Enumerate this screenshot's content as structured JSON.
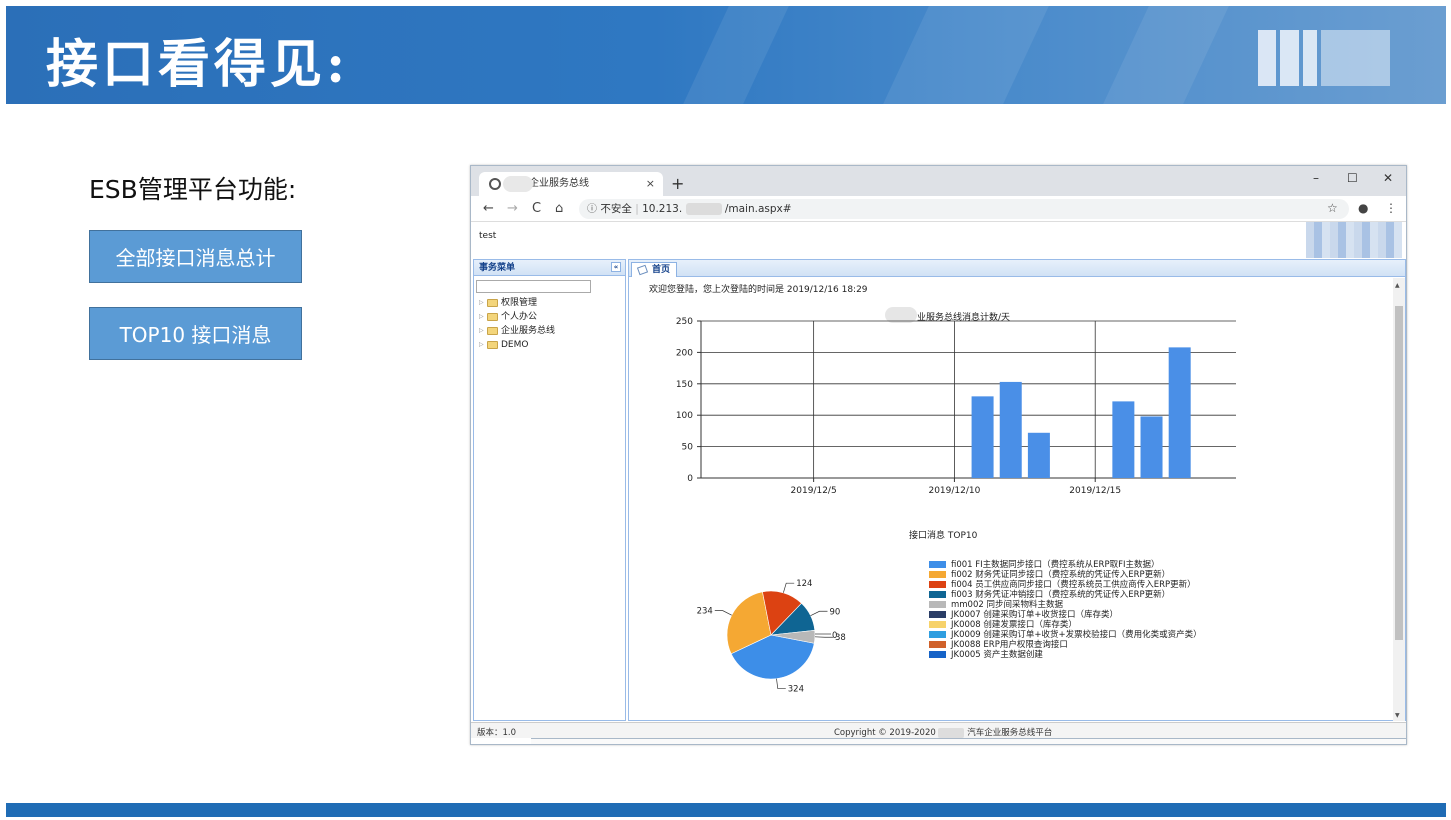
{
  "slide": {
    "title": "接口看得见:",
    "heading": "ESB管理平台功能:",
    "button_all": "全部接口消息总计",
    "button_top10": "TOP10 接口消息"
  },
  "browser": {
    "tab_title": "车企业服务总线",
    "tab_close": "×",
    "tab_new": "+",
    "win_min": "–",
    "win_max": "☐",
    "win_close": "✕",
    "nav_back": "←",
    "nav_forward": "→",
    "nav_reload": "C",
    "nav_home": "⌂",
    "info_icon": "ⓘ",
    "security": "不安全",
    "url_prefix": "10.213.",
    "url_suffix": "/main.aspx#",
    "star_icon": "☆",
    "profile_icon": "●",
    "menu_icon": "⋮"
  },
  "app": {
    "user": "test",
    "menu_title": "事务菜单",
    "menu_collapse": "«",
    "menu_items": [
      "权限管理",
      "个人办公",
      "企业服务总线",
      "DEMO"
    ],
    "tab_home": "首页",
    "welcome": "欢迎您登陆，您上次登陆的时间是 2019/12/16 18:29",
    "version": "版本：1.0",
    "copyright_prefix": "Copyright © 2019-2020",
    "copyright_suffix": "汽车企业服务总线平台"
  },
  "chart_data": [
    {
      "type": "bar",
      "title": "业服务总线消息计数/天",
      "ylim": [
        0,
        250
      ],
      "yticks": [
        0,
        50,
        100,
        150,
        200,
        250
      ],
      "xticks": [
        "2019/12/5",
        "2019/12/10",
        "2019/12/15"
      ],
      "bars": [
        {
          "date": "2019/12/11",
          "value": 130
        },
        {
          "date": "2019/12/12",
          "value": 153
        },
        {
          "date": "2019/12/13",
          "value": 72
        },
        {
          "date": "2019/12/16",
          "value": 122
        },
        {
          "date": "2019/12/17",
          "value": 98
        },
        {
          "date": "2019/12/18",
          "value": 208
        }
      ],
      "bar_color": "#4a8fe7",
      "grid": true
    },
    {
      "type": "pie",
      "title": "接口消息 TOP10",
      "labels_shown": [
        "324",
        "234",
        "124",
        "90",
        "38",
        "0"
      ],
      "slices": [
        {
          "name": "fi001 FI主数据同步接口（费控系统从ERP取FI主数据）",
          "value": 324,
          "color": "#3d8ee8"
        },
        {
          "name": "fi002 财务凭证同步接口（费控系统的凭证传入ERP更新）",
          "value": 234,
          "color": "#f5a833"
        },
        {
          "name": "fi004 员工供应商同步接口（费控系统员工供应商传入ERP更新）",
          "value": 124,
          "color": "#dc4212"
        },
        {
          "name": "fi003 财务凭证冲销接口（费控系统的凭证传入ERP更新）",
          "value": 90,
          "color": "#0f6593"
        },
        {
          "name": "mm002 同步间采物料主数据",
          "value": 38,
          "color": "#b8b8b8"
        },
        {
          "name": "JK0007 创建采购订单+收货接口（库存类）",
          "value": 0,
          "color": "#2a3d66"
        },
        {
          "name": "JK0008 创建发票接口（库存类）",
          "value": 0,
          "color": "#f7d26a"
        },
        {
          "name": "JK0009 创建采购订单+收货+发票校验接口（费用化类或资产类）",
          "value": 0,
          "color": "#2f9ee0"
        },
        {
          "name": "JK0088 ERP用户权限查询接口",
          "value": 0,
          "color": "#d0612a"
        },
        {
          "name": "JK0005 资产主数据创建",
          "value": 0,
          "color": "#1663c7"
        }
      ],
      "legend": "right"
    }
  ]
}
